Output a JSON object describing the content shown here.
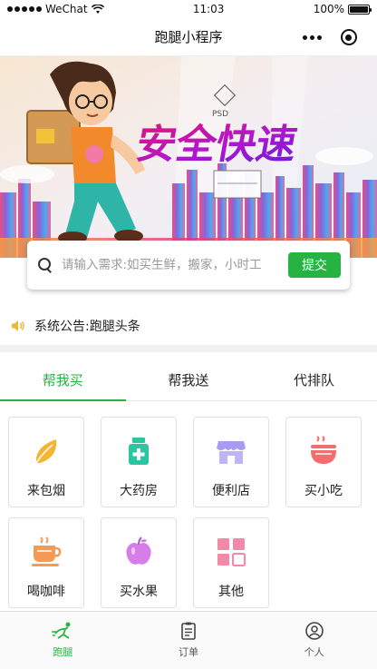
{
  "status_bar": {
    "carrier": "WeChat",
    "time": "11:03",
    "battery": "100%",
    "battery_level": 1.0
  },
  "nav": {
    "title": "跑腿小程序"
  },
  "banner": {
    "headline": "安全快速"
  },
  "search": {
    "placeholder": "请输入需求:如买生鲜，搬家，小时工",
    "submit_label": "提交"
  },
  "notice": {
    "text": "系统公告:跑腿头条"
  },
  "tabs": [
    {
      "label": "帮我买",
      "active": true
    },
    {
      "label": "帮我送",
      "active": false
    },
    {
      "label": "代排队",
      "active": false
    }
  ],
  "services": [
    {
      "label": "来包烟",
      "icon": "leaf-icon",
      "color": "#f2b632"
    },
    {
      "label": "大药房",
      "icon": "medicine-icon",
      "color": "#29c7a0"
    },
    {
      "label": "便利店",
      "icon": "store-icon",
      "color": "#a99cf0"
    },
    {
      "label": "买小吃",
      "icon": "noodle-bowl-icon",
      "color": "#f26e6e"
    },
    {
      "label": "喝咖啡",
      "icon": "coffee-icon",
      "color": "#f59a55"
    },
    {
      "label": "买水果",
      "icon": "apple-icon",
      "color": "#d77de8"
    },
    {
      "label": "其他",
      "icon": "grid-icon",
      "color": "#f289a8"
    }
  ],
  "tab_bar": [
    {
      "label": "跑腿",
      "icon": "runner-icon",
      "active": true
    },
    {
      "label": "订单",
      "icon": "clipboard-icon",
      "active": false
    },
    {
      "label": "个人",
      "icon": "person-icon",
      "active": false
    }
  ],
  "colors": {
    "accent": "#26b341"
  }
}
